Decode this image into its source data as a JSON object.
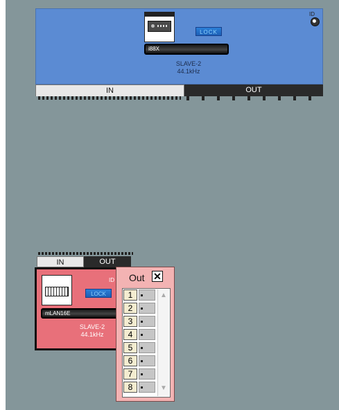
{
  "device_top": {
    "model": "i88X",
    "lock_label": "LOCK",
    "sync": "SLAVE-2",
    "rate": "44.1kHz",
    "id_label": "ID",
    "tab_in": "IN",
    "tab_out": "OUT",
    "panel_color": "#5b8bd3"
  },
  "device_bottom": {
    "model": "mLAN16E",
    "lock_label": "LOCK",
    "sync": "SLAVE-2",
    "rate": "44.1kHz",
    "id_label": "ID",
    "tab_in": "IN",
    "tab_out": "OUT",
    "panel_color": "#e8707a"
  },
  "popup": {
    "title": "Out",
    "close_glyph": "✕",
    "channels": [
      "1",
      "2",
      "3",
      "4",
      "5",
      "6",
      "7",
      "8"
    ],
    "scroll_up_glyph": "▲",
    "scroll_down_glyph": "▼"
  }
}
